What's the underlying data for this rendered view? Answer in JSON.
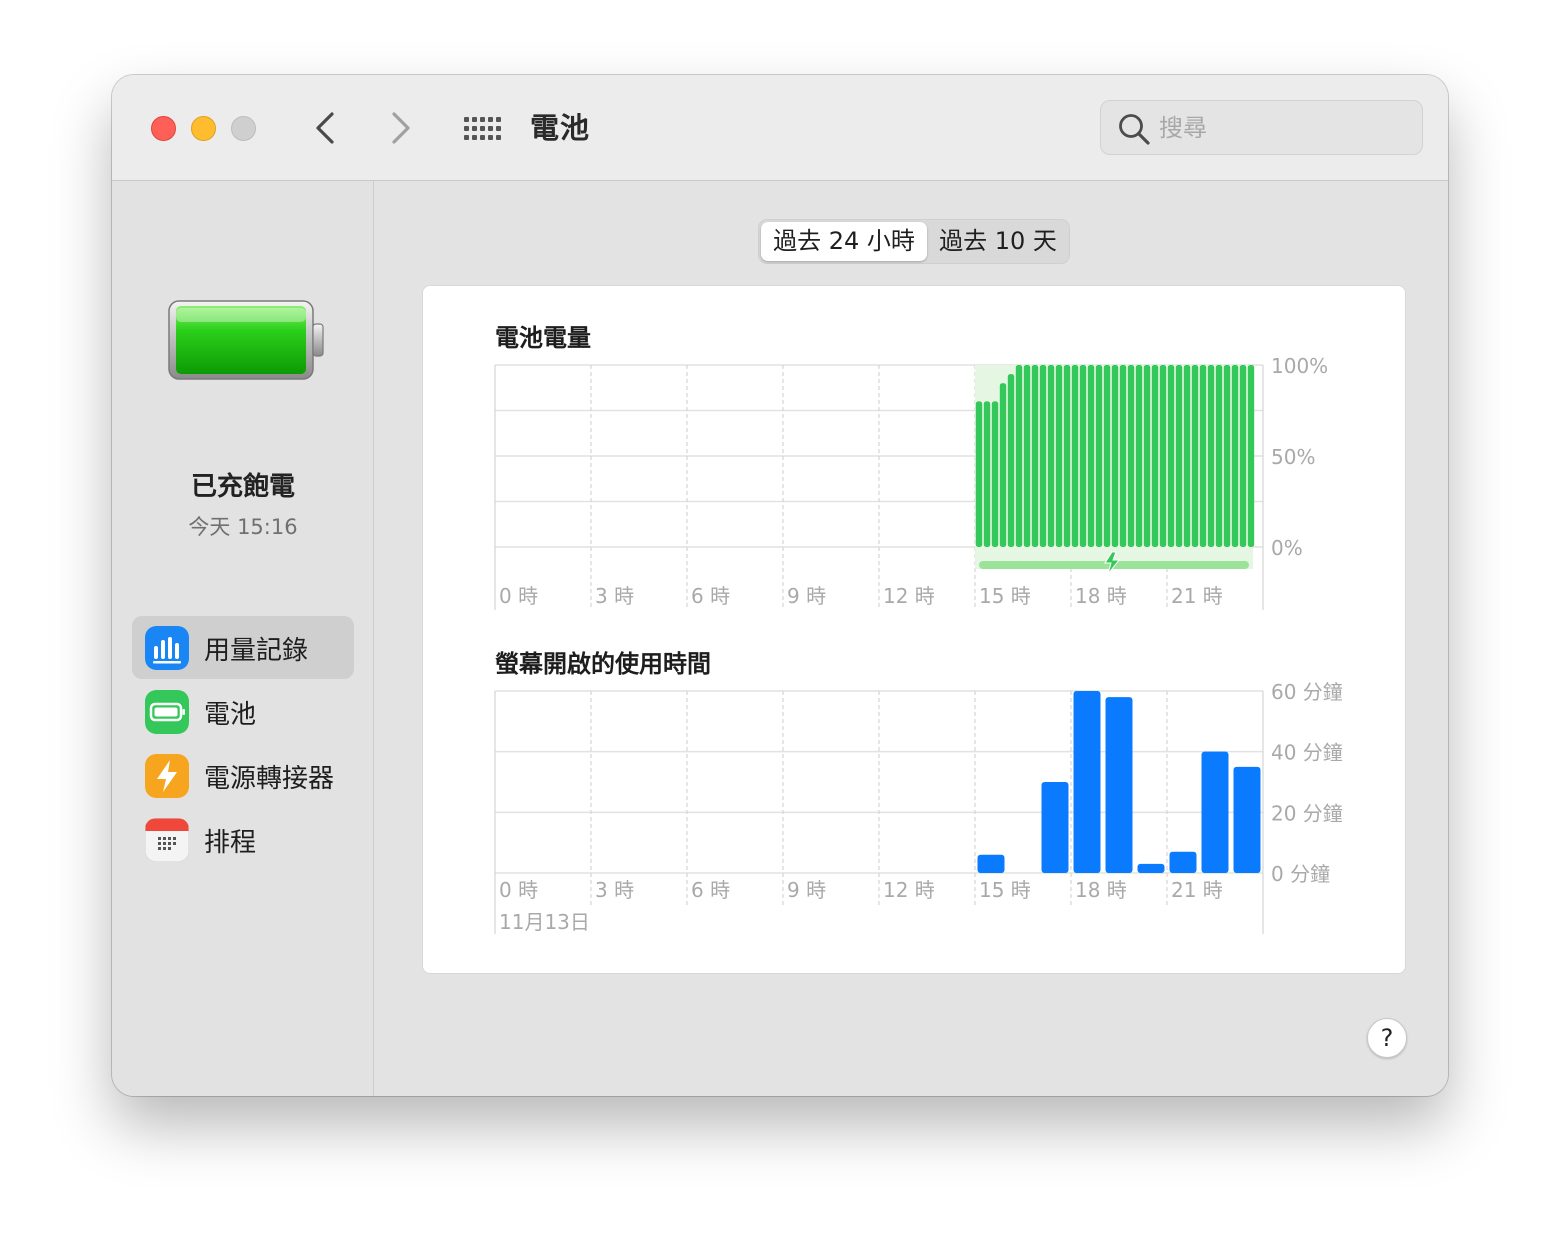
{
  "window": {
    "title": "電池",
    "search_placeholder": "搜尋"
  },
  "sidebar": {
    "status_title": "已充飽電",
    "status_time": "今天 15:16",
    "items": [
      {
        "label": "用量記錄",
        "icon": "usage-chart-icon",
        "color": "#1a86f5"
      },
      {
        "label": "電池",
        "icon": "battery-icon",
        "color": "#34c759"
      },
      {
        "label": "電源轉接器",
        "icon": "lightning-icon",
        "color": "#f7a51f"
      },
      {
        "label": "排程",
        "icon": "calendar-icon",
        "color": "#f2f2f2"
      }
    ]
  },
  "segmented": {
    "options": [
      "過去 24 小時",
      "過去 10 天"
    ],
    "selected": "過去 24 小時"
  },
  "chart_data": [
    {
      "type": "bar",
      "title": "電池電量",
      "x_tick_labels": [
        "0 時",
        "3 時",
        "6 時",
        "9 時",
        "12 時",
        "15 時",
        "18 時",
        "21 時"
      ],
      "y_tick_labels": [
        "100%",
        "50%",
        "0%"
      ],
      "ylim": [
        0,
        100
      ],
      "color": "#34c759",
      "series": [
        {
          "x_hours_start": 15.0,
          "interval_minutes": 15,
          "values": [
            80,
            80,
            80,
            90,
            95,
            100,
            100,
            100,
            100,
            100,
            100,
            100,
            100,
            100,
            100,
            100,
            100,
            100,
            100,
            100,
            100,
            100,
            100,
            100,
            100,
            100,
            100,
            100,
            100,
            100,
            100,
            100,
            100,
            100,
            100
          ]
        }
      ],
      "charging_range_hours": [
        15.0,
        23.5
      ]
    },
    {
      "type": "bar",
      "title": "螢幕開啟的使用時間",
      "x_tick_labels": [
        "0 時",
        "3 時",
        "6 時",
        "9 時",
        "12 時",
        "15 時",
        "18 時",
        "21 時"
      ],
      "date_label": "11月13日",
      "y_tick_labels": [
        "60 分鐘",
        "40 分鐘",
        "20 分鐘",
        "0 分鐘"
      ],
      "ylim": [
        0,
        60
      ],
      "ylabel_unit": "分鐘",
      "color": "#0a7aff",
      "categories_hours": [
        15,
        16,
        17,
        18,
        19,
        20,
        21,
        22,
        23
      ],
      "values": [
        6,
        0,
        30,
        60,
        58,
        3,
        7,
        40,
        35
      ]
    }
  ],
  "help": {
    "label": "?"
  }
}
